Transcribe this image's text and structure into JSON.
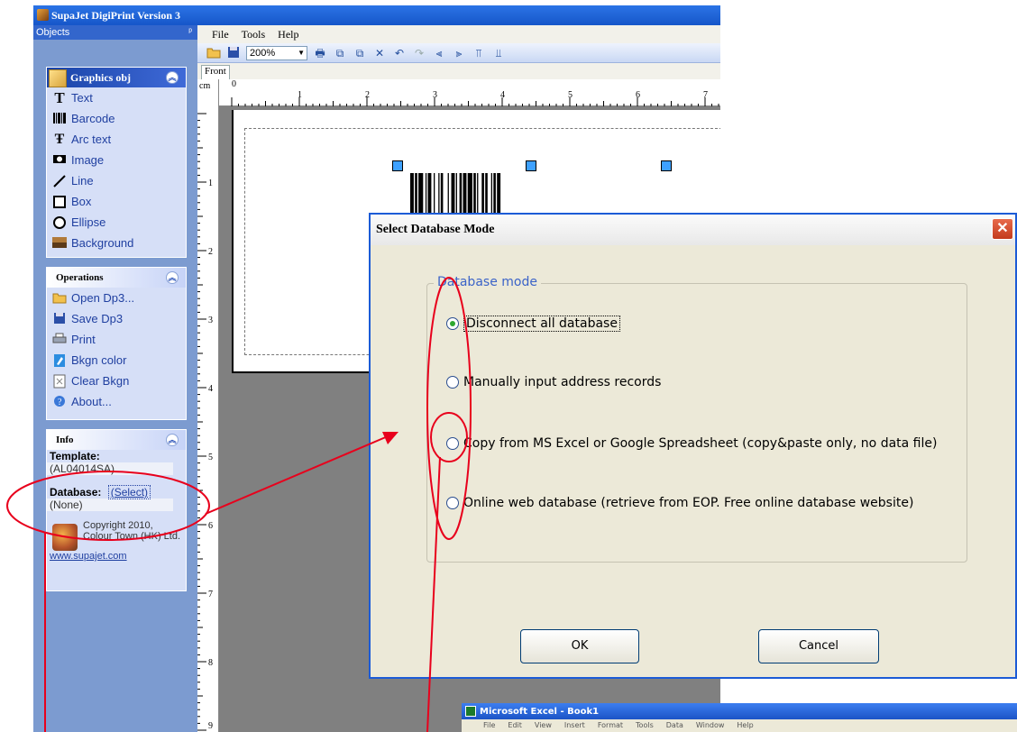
{
  "app": {
    "title": "SupaJet DigiPrint Version 3",
    "objects_label": "Objects",
    "pin_glyph": "ᵖ",
    "menu": [
      "File",
      "Tools",
      "Help"
    ],
    "zoom": "200%",
    "tab_front": "Front",
    "ruler_unit": "cm",
    "ruler_top_ticks": [
      "0",
      "1",
      "2",
      "3",
      "4",
      "5",
      "6",
      "7"
    ],
    "ruler_left_ticks": [
      "1",
      "2",
      "3",
      "4",
      "5",
      "6",
      "7",
      "8",
      "9"
    ]
  },
  "sidebar": {
    "graphics": {
      "title": "Graphics obj",
      "items": [
        {
          "label": "Text",
          "icon": "text-icon"
        },
        {
          "label": "Barcode",
          "icon": "barcode-icon"
        },
        {
          "label": "Arc text",
          "icon": "arc-text-icon"
        },
        {
          "label": "Image",
          "icon": "camera-icon"
        },
        {
          "label": "Line",
          "icon": "line-icon"
        },
        {
          "label": "Box",
          "icon": "box-icon"
        },
        {
          "label": "Ellipse",
          "icon": "ellipse-icon"
        },
        {
          "label": "Background",
          "icon": "background-icon"
        }
      ]
    },
    "operations": {
      "title": "Operations",
      "items": [
        {
          "label": "Open Dp3...",
          "icon": "folder-icon"
        },
        {
          "label": "Save Dp3",
          "icon": "floppy-icon"
        },
        {
          "label": "Print",
          "icon": "printer-icon"
        },
        {
          "label": "Bkgn color",
          "icon": "paint-icon"
        },
        {
          "label": "Clear Bkgn",
          "icon": "clear-icon"
        },
        {
          "label": "About...",
          "icon": "info-icon"
        }
      ]
    },
    "info": {
      "title": "Info",
      "template_label": "Template:",
      "template_value": "(AL04014SA)",
      "database_label": "Database:",
      "database_link": "(Select)",
      "database_value": "(None)",
      "copyright": "Copyright 2010, Colour Town (HK) Ltd.",
      "website": "www.supajet.com"
    }
  },
  "dialog": {
    "title": "Select Database Mode",
    "close_glyph": "✕",
    "group_label": "Database mode",
    "options": [
      {
        "label": "Disconnect all database",
        "selected": true
      },
      {
        "label": "Manually input address records",
        "selected": false
      },
      {
        "label": "Copy from MS Excel or Google Spreadsheet (copy&paste only, no data file)",
        "selected": false
      },
      {
        "label": "Online web database (retrieve from EOP. Free online database website)",
        "selected": false
      }
    ],
    "ok": "OK",
    "cancel": "Cancel"
  },
  "excel": {
    "title": "Microsoft Excel - Book1",
    "menu": [
      "File",
      "Edit",
      "View",
      "Insert",
      "Format",
      "Tools",
      "Data",
      "Window",
      "Help"
    ]
  },
  "colors": {
    "annotation": "#e8001c",
    "titlebar": "#1656c9",
    "panel": "#7c9bd0"
  }
}
